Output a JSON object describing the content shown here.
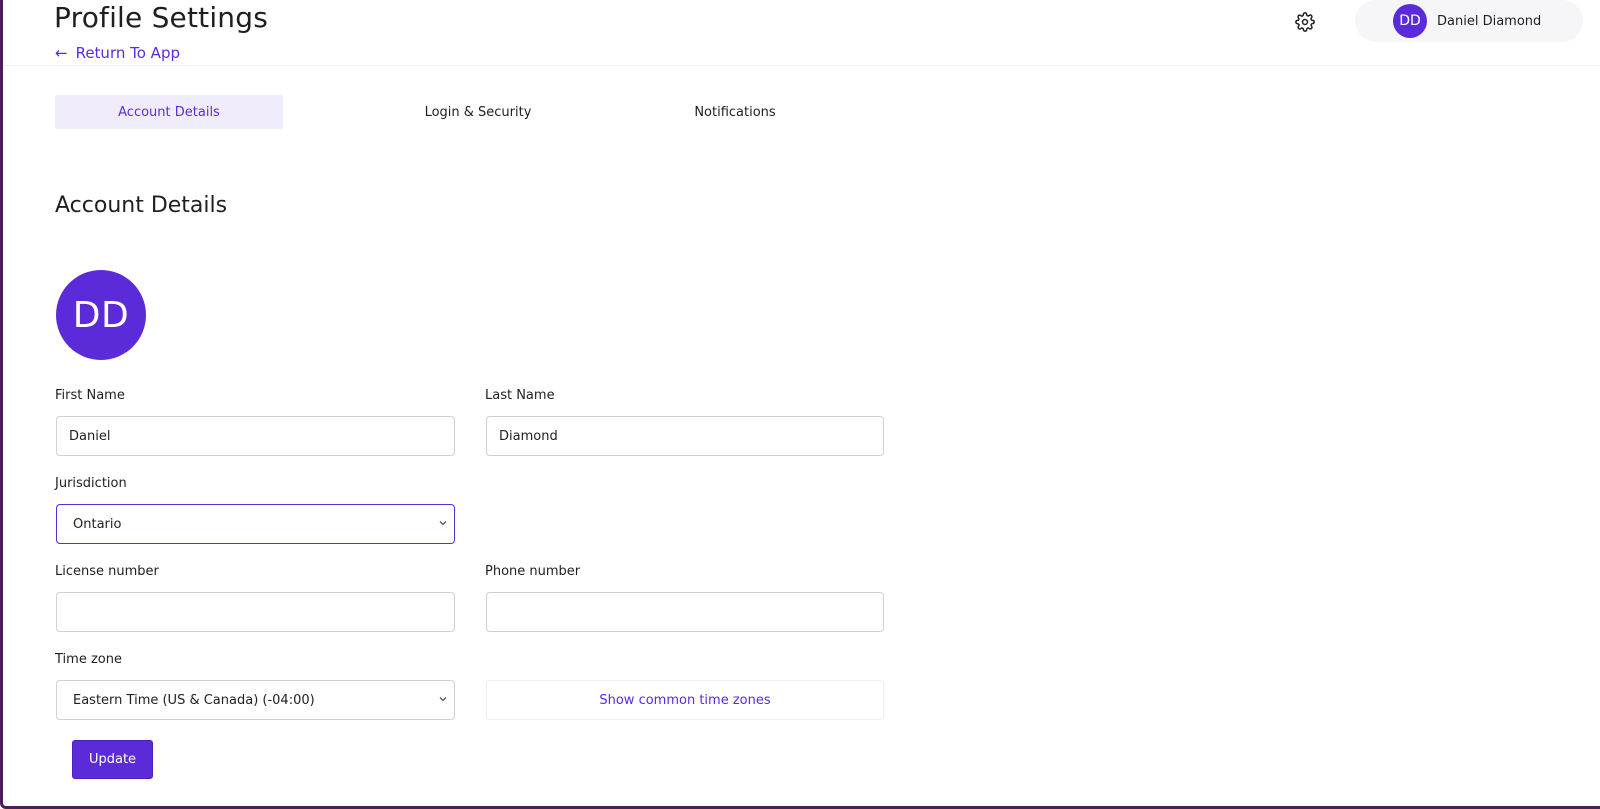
{
  "header": {
    "title": "Profile Settings",
    "return_link": "Return To App",
    "user": {
      "initials": "DD",
      "name": "Daniel Diamond"
    }
  },
  "tabs": [
    {
      "label": "Account Details",
      "active": true
    },
    {
      "label": "Login & Security",
      "active": false
    },
    {
      "label": "Notifications",
      "active": false
    }
  ],
  "section": {
    "title": "Account Details",
    "avatar_initials": "DD"
  },
  "form": {
    "first_name": {
      "label": "First Name",
      "value": "Daniel"
    },
    "last_name": {
      "label": "Last Name",
      "value": "Diamond"
    },
    "jurisdiction": {
      "label": "Jurisdiction",
      "value": "Ontario"
    },
    "license_number": {
      "label": "License number",
      "value": ""
    },
    "phone_number": {
      "label": "Phone number",
      "value": ""
    },
    "time_zone": {
      "label": "Time zone",
      "value": "Eastern Time (US & Canada) (-04:00)"
    },
    "common_tz_link": "Show common time zones",
    "submit_label": "Update"
  },
  "colors": {
    "accent": "#5b2bd9",
    "active_tab_bg": "#f0ecfc",
    "page_border": "#4a1d5e"
  },
  "icons": {
    "return": "arrow-left-icon",
    "settings": "gear-icon",
    "select": "chevron-down-icon"
  }
}
